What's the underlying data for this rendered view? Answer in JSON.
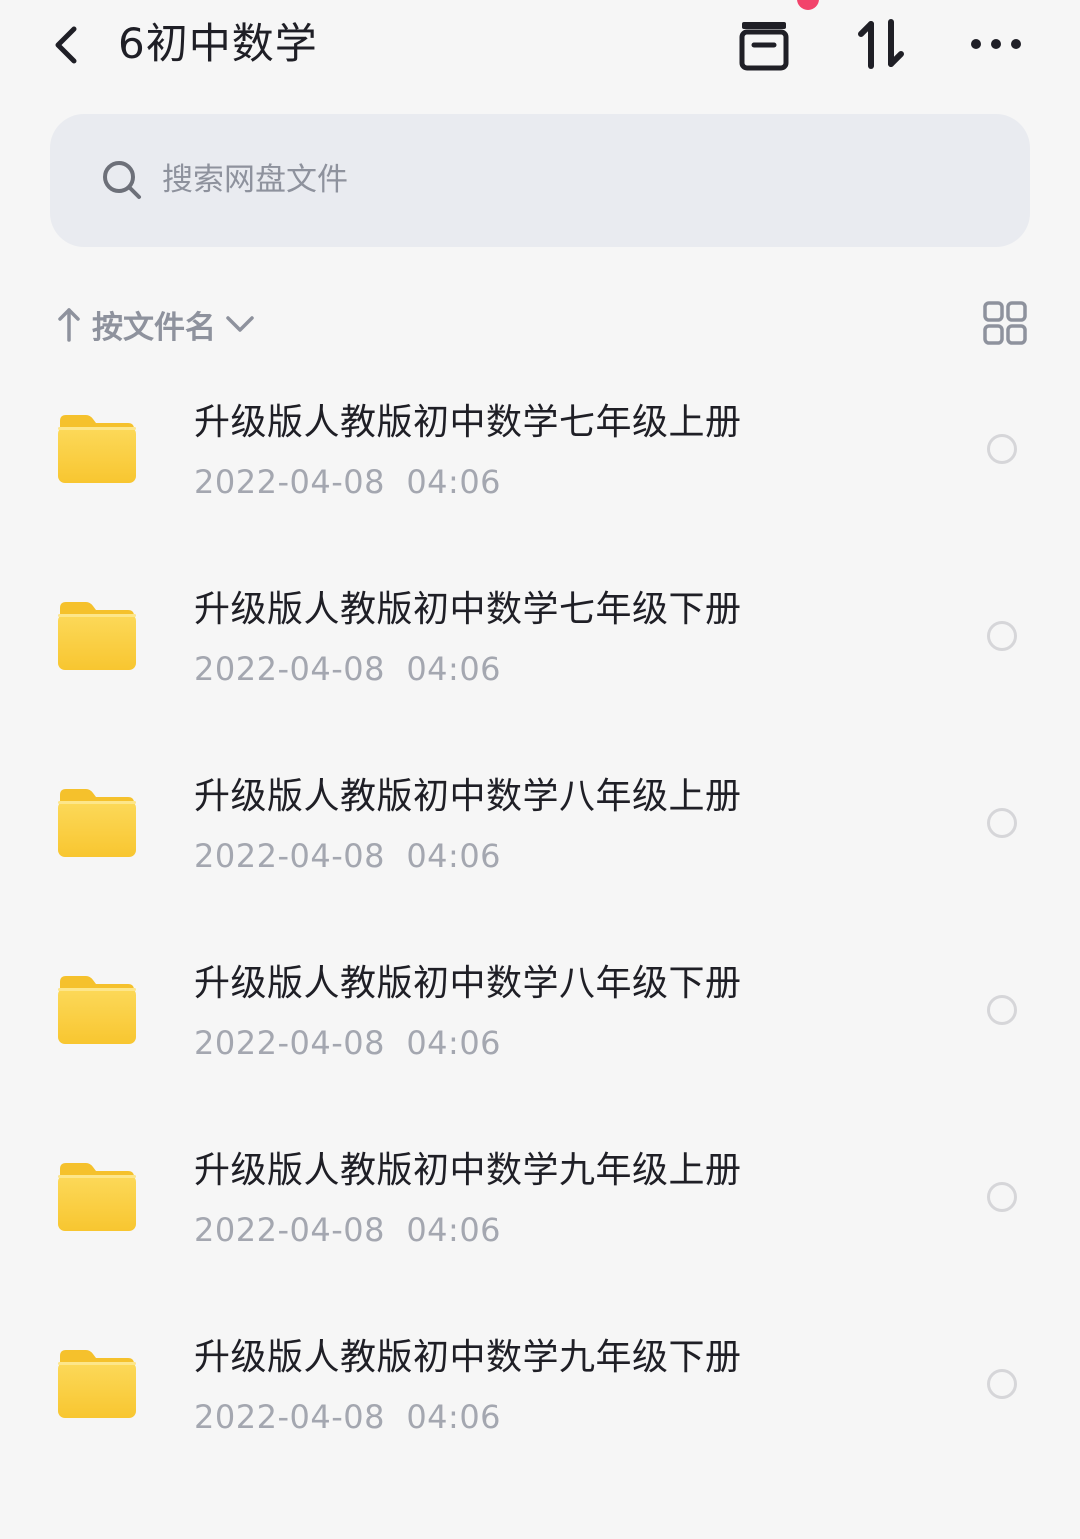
{
  "header": {
    "title": "6初中数学",
    "back_icon": "chevron-left-icon",
    "icons": [
      "archive-box-icon",
      "transfer-arrows-icon",
      "more-dots-icon"
    ],
    "notification_color": "#f2436b"
  },
  "search": {
    "placeholder": "搜索网盘文件",
    "value": ""
  },
  "sort": {
    "label": "按文件名",
    "direction_icon": "arrow-up-icon",
    "dropdown_icon": "chevron-down-icon",
    "view_toggle_icon": "grid-view-icon"
  },
  "files": [
    {
      "name": "升级版人教版初中数学七年级上册",
      "date": "2022-04-08  04:06",
      "type": "folder",
      "selected": false
    },
    {
      "name": "升级版人教版初中数学七年级下册",
      "date": "2022-04-08  04:06",
      "type": "folder",
      "selected": false
    },
    {
      "name": "升级版人教版初中数学八年级上册",
      "date": "2022-04-08  04:06",
      "type": "folder",
      "selected": false
    },
    {
      "name": "升级版人教版初中数学八年级下册",
      "date": "2022-04-08  04:06",
      "type": "folder",
      "selected": false
    },
    {
      "name": "升级版人教版初中数学九年级上册",
      "date": "2022-04-08  04:06",
      "type": "folder",
      "selected": false
    },
    {
      "name": "升级版人教版初中数学九年级下册",
      "date": "2022-04-08  04:06",
      "type": "folder",
      "selected": false
    }
  ],
  "colors": {
    "background": "#f6f6f6",
    "search_bg": "#e9ebf0",
    "folder": "#fbd249",
    "secondary_text": "#a4a7b0"
  }
}
